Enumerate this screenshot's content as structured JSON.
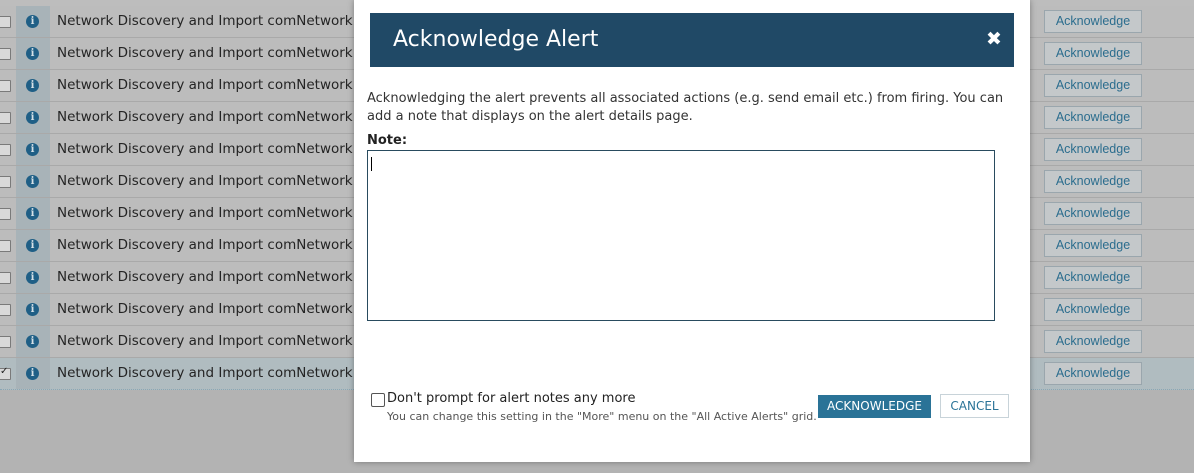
{
  "grid": {
    "rows": [
      {
        "text": "Network Discovery and Import comNetwork Discovery",
        "action": "Acknowledge",
        "checked": false
      },
      {
        "text": "Network Discovery and Import comNetwork Discovery",
        "action": "Acknowledge",
        "checked": false
      },
      {
        "text": "Network Discovery and Import comNetwork Discovery",
        "action": "Acknowledge",
        "checked": false
      },
      {
        "text": "Network Discovery and Import comNetwork Discovery",
        "action": "Acknowledge",
        "checked": false
      },
      {
        "text": "Network Discovery and Import comNetwork Discovery",
        "action": "Acknowledge",
        "checked": false
      },
      {
        "text": "Network Discovery and Import comNetwork Discovery",
        "action": "Acknowledge",
        "checked": false
      },
      {
        "text": "Network Discovery and Import comNetwork Discovery",
        "action": "Acknowledge",
        "checked": false
      },
      {
        "text": "Network Discovery and Import comNetwork Discovery",
        "action": "Acknowledge",
        "checked": false
      },
      {
        "text": "Network Discovery and Import comNetwork Discovery",
        "action": "Acknowledge",
        "checked": false
      },
      {
        "text": "Network Discovery and Import comNetwork Discovery",
        "action": "Acknowledge",
        "checked": false
      },
      {
        "text": "Network Discovery and Import comNetwork Discovery",
        "action": "Acknowledge",
        "checked": false
      },
      {
        "text": "Network Discovery and Import comNetwork Discovery",
        "action": "Acknowledge",
        "checked": true
      }
    ],
    "row_icon": "info-icon",
    "row_icon_glyph": "i"
  },
  "dialog": {
    "title": "Acknowledge Alert",
    "close_glyph": "✖",
    "description": "Acknowledging the alert prevents all associated actions (e.g. send email etc.) from firing. You can add a note that displays on the alert details page.",
    "note_label": "Note:",
    "note_value": "",
    "prompt_label": "Don't prompt for alert notes any more",
    "prompt_checked": false,
    "prompt_hint": "You can change this setting in the \"More\" menu on the \"All Active Alerts\" grid.",
    "acknowledge_label": "ACKNOWLEDGE",
    "cancel_label": "CANCEL"
  },
  "colors": {
    "header_bg": "#204966",
    "primary_button": "#2a7397",
    "overlay_grid": "#bdbdbd"
  }
}
